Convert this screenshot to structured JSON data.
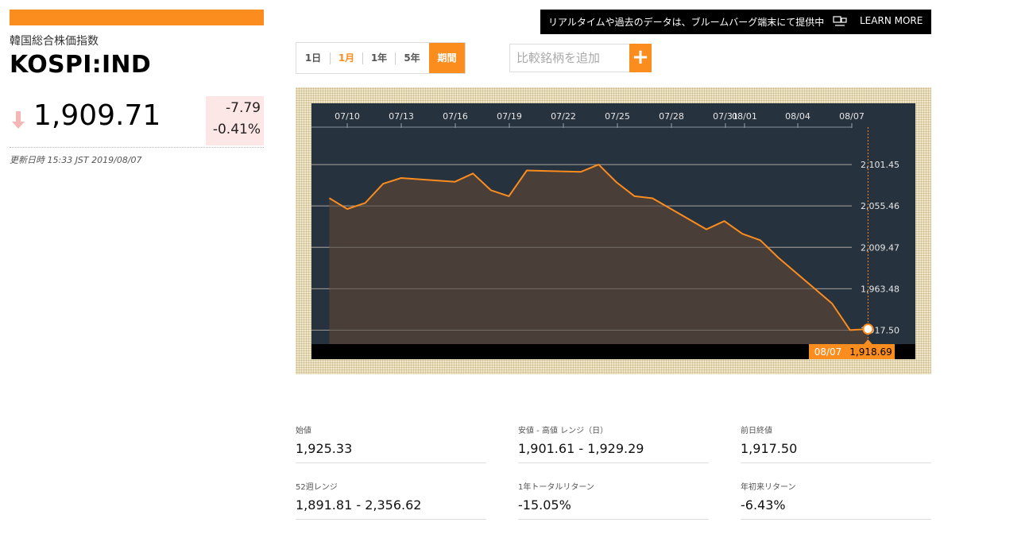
{
  "header": {
    "index_name": "韓国総合株価指数",
    "ticker": "KOSPI:IND",
    "price": "1,909.71",
    "change": "-7.79",
    "change_pct": "-0.41%",
    "updated": "更新日時 15:33 JST 2019/08/07",
    "direction_icon": "arrow-down-icon",
    "down_color": "#fde6e6"
  },
  "banner": {
    "text": "リアルタイムや過去のデータは、ブルームバーグ端末にて提供中",
    "icon": "terminal-icon",
    "learn_more": "LEARN MORE"
  },
  "range_tabs": {
    "items": [
      "1日",
      "1月",
      "1年",
      "5年",
      "期間"
    ],
    "selected": "1月"
  },
  "compare": {
    "placeholder": "比較銘柄を追加",
    "button": "+"
  },
  "colors": {
    "accent": "#fb8c1e",
    "chart_bg": "#27323f",
    "area_fill": "#4b3f38"
  },
  "chart_data": {
    "type": "area",
    "x_ticks": [
      "07/10",
      "07/13",
      "07/16",
      "07/19",
      "07/22",
      "07/25",
      "07/28",
      "07/31",
      "08/01",
      "08/04",
      "08/07"
    ],
    "y_ticks": [
      "2,101.45",
      "2,055.46",
      "2,009.47",
      "1,963.48",
      "1,917.50"
    ],
    "y_tick_values": [
      2101.45,
      2055.46,
      2009.47,
      1963.48,
      1917.5
    ],
    "ylim": [
      1902,
      2143
    ],
    "x": [
      "07/08",
      "07/09",
      "07/10",
      "07/11",
      "07/12",
      "07/15",
      "07/16",
      "07/17",
      "07/18",
      "07/19",
      "07/22",
      "07/23",
      "07/24",
      "07/25",
      "07/26",
      "07/29",
      "07/30",
      "07/31",
      "08/01",
      "08/02",
      "08/05",
      "08/06",
      "08/07"
    ],
    "x_pos": [
      -1,
      0,
      1,
      2,
      3,
      6,
      7,
      8,
      9,
      10,
      13,
      14,
      15,
      16,
      17,
      20,
      21,
      22,
      23,
      24,
      27,
      28,
      29
    ],
    "values": [
      2064.17,
      2052.03,
      2058.78,
      2080.16,
      2086.48,
      2082.38,
      2091.52,
      2072.92,
      2066.26,
      2094.9,
      2093.33,
      2101.45,
      2081.64,
      2066.26,
      2064.0,
      2029.48,
      2038.68,
      2024.55,
      2017.34,
      1998.13,
      1946.98,
      1917.5,
      1918.69
    ],
    "crosshair": {
      "date": "08/07",
      "value": "1,918.69"
    }
  },
  "stats": [
    {
      "label": "始値",
      "value": "1,925.33"
    },
    {
      "label": "安値 - 高値 レンジ（日）",
      "value": "1,901.61 - 1,929.29"
    },
    {
      "label": "前日終値",
      "value": "1,917.50"
    },
    {
      "label": "52週レンジ",
      "value": "1,891.81 - 2,356.62"
    },
    {
      "label": "1年トータルリターン",
      "value": "-15.05%"
    },
    {
      "label": "年初来リターン",
      "value": "-6.43%"
    }
  ]
}
